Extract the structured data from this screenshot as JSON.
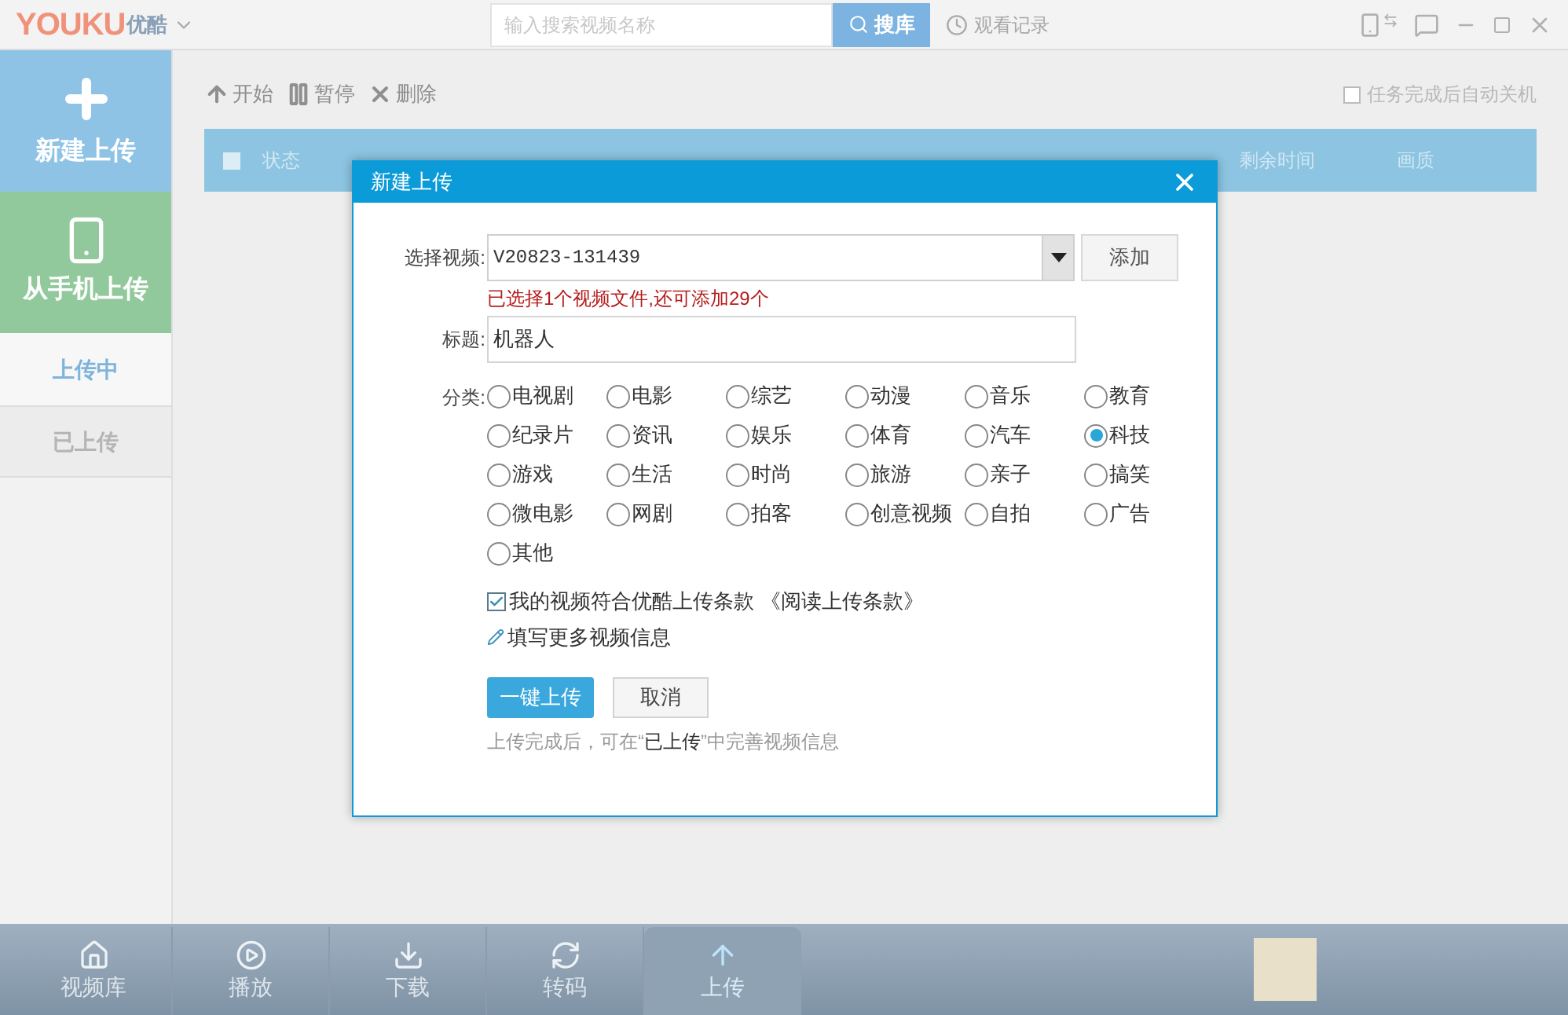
{
  "app": {
    "logo_latin": "YOUKU",
    "logo_cn": "优酷"
  },
  "search": {
    "placeholder": "输入搜索视频名称",
    "button": "搜库"
  },
  "history": "观看记录",
  "sidebar": {
    "new_upload": "新建上传",
    "phone_upload": "从手机上传",
    "items": [
      {
        "label": "上传中",
        "selected": true
      },
      {
        "label": "已上传",
        "selected": false
      }
    ]
  },
  "toolbar": {
    "actions": [
      {
        "kind": "start",
        "label": "开始"
      },
      {
        "kind": "pause",
        "label": "暂停"
      },
      {
        "kind": "delete",
        "label": "删除"
      }
    ],
    "shutdown": {
      "label": "任务完成后自动关机",
      "checked": false
    }
  },
  "table": {
    "select_all": false,
    "columns": [
      {
        "label": "状态"
      },
      {
        "label": "剩余时间"
      },
      {
        "label": "画质"
      }
    ]
  },
  "dialog": {
    "title": "新建上传",
    "video_label": "选择视频:",
    "video_value": "V20823-131439",
    "add_button": "添加",
    "notice": "已选择1个视频文件,还可添加29个",
    "title_label": "标题:",
    "title_value": "机器人",
    "category_label": "分类:",
    "categories": [
      {
        "label": "电视剧",
        "selected": false
      },
      {
        "label": "电影",
        "selected": false
      },
      {
        "label": "综艺",
        "selected": false
      },
      {
        "label": "动漫",
        "selected": false
      },
      {
        "label": "音乐",
        "selected": false
      },
      {
        "label": "教育",
        "selected": false
      },
      {
        "label": "纪录片",
        "selected": false
      },
      {
        "label": "资讯",
        "selected": false
      },
      {
        "label": "娱乐",
        "selected": false
      },
      {
        "label": "体育",
        "selected": false
      },
      {
        "label": "汽车",
        "selected": false
      },
      {
        "label": "科技",
        "selected": true
      },
      {
        "label": "游戏",
        "selected": false
      },
      {
        "label": "生活",
        "selected": false
      },
      {
        "label": "时尚",
        "selected": false
      },
      {
        "label": "旅游",
        "selected": false
      },
      {
        "label": "亲子",
        "selected": false
      },
      {
        "label": "搞笑",
        "selected": false
      },
      {
        "label": "微电影",
        "selected": false
      },
      {
        "label": "网剧",
        "selected": false
      },
      {
        "label": "拍客",
        "selected": false
      },
      {
        "label": "创意视频",
        "selected": false
      },
      {
        "label": "自拍",
        "selected": false
      },
      {
        "label": "广告",
        "selected": false
      },
      {
        "label": "其他",
        "selected": false
      }
    ],
    "agree": {
      "label": "我的视频符合优酷上传条款",
      "checked": true
    },
    "terms_link": "《阅读上传条款》",
    "more_info": "填写更多视频信息",
    "upload_button": "一键上传",
    "cancel_button": "取消",
    "hint": "上传完成后，可在“**已上传**”中完善视频信息"
  },
  "bottom_nav": [
    {
      "kind": "home",
      "label": "视频库",
      "selected": false
    },
    {
      "kind": "play",
      "label": "播放",
      "selected": false
    },
    {
      "kind": "download",
      "label": "下载",
      "selected": false
    },
    {
      "kind": "convert",
      "label": "转码",
      "selected": false
    },
    {
      "kind": "upload",
      "label": "上传",
      "selected": true
    }
  ]
}
